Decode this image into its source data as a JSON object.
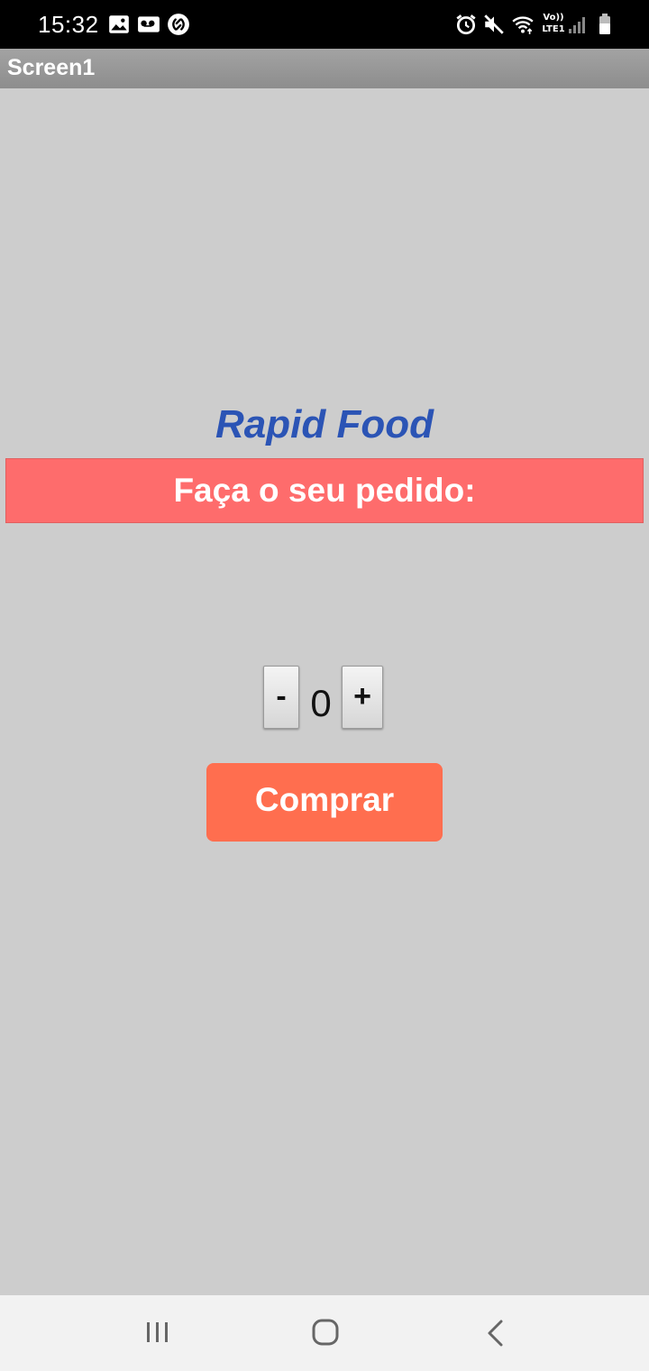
{
  "status_bar": {
    "time": "15:32",
    "left_icons": [
      "image-icon",
      "voicemail-icon",
      "shazam-icon"
    ],
    "right_icons": [
      "alarm-icon",
      "mute-icon",
      "wifi-icon",
      "lte-signal-icon",
      "battery-icon"
    ],
    "network_label_top": "Vo))",
    "network_label_bottom": "LTE1"
  },
  "app_bar": {
    "title": "Screen1"
  },
  "main": {
    "brand_title": "Rapid Food",
    "order_prompt": "Faça o seu pedido:",
    "stepper": {
      "minus_label": "-",
      "quantity": "0",
      "plus_label": "+"
    },
    "buy_button_label": "Comprar"
  },
  "nav_bar": {
    "buttons": [
      "recent-apps-icon",
      "home-icon",
      "back-icon"
    ]
  },
  "colors": {
    "background": "#cdcdcd",
    "brand_blue": "#2b54b5",
    "banner_red": "#fe6c6c",
    "button_orange": "#ff6e4f"
  }
}
